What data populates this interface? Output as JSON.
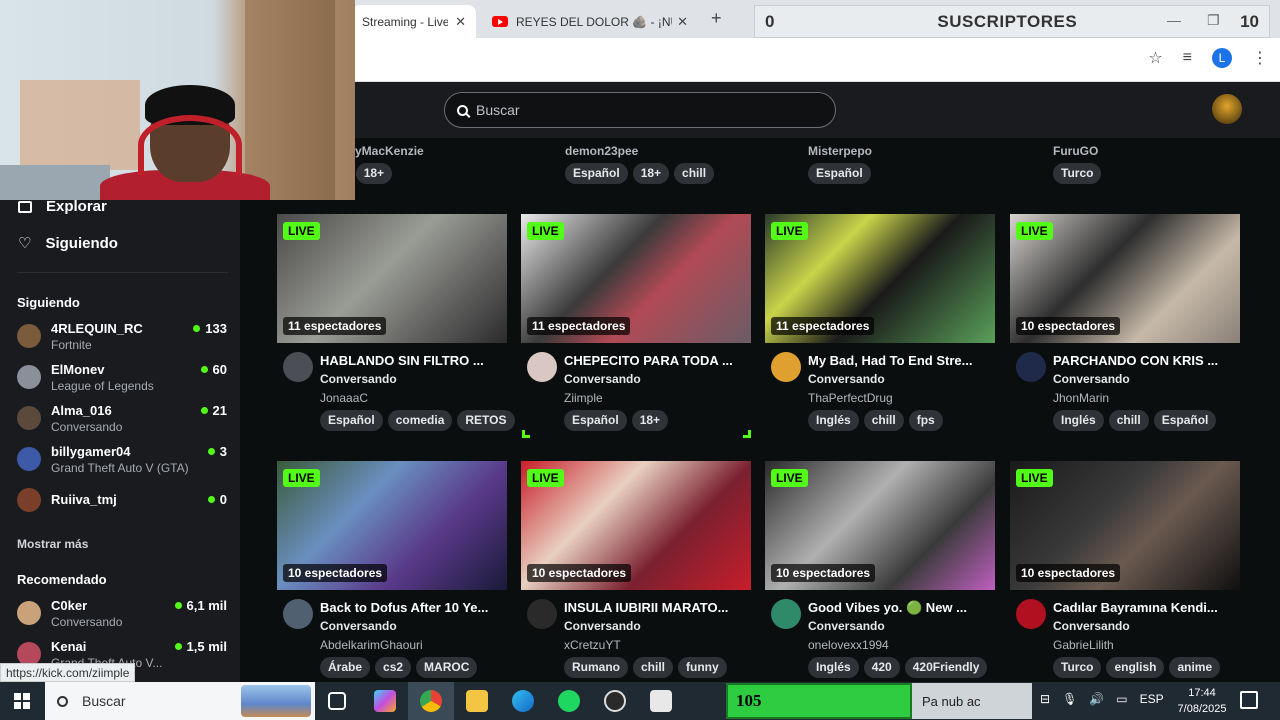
{
  "browser": {
    "tabs": [
      {
        "label": "Streaming - Live S",
        "active": true
      },
      {
        "label": "REYES DEL DOLOR 🪨 - ¡NUEVA",
        "active": false
      }
    ],
    "new_tab": "+",
    "close_glyph": "✕"
  },
  "subscribers": {
    "left": "0",
    "label": "SUSCRIPTORES",
    "right": "10"
  },
  "kick": {
    "search_placeholder": "Buscar",
    "nav": [
      {
        "label": "Explorar",
        "icon": "explore-icon"
      },
      {
        "label": "Siguiendo",
        "icon": "heart-icon"
      }
    ],
    "following_heading": "Siguiendo",
    "following": [
      {
        "name": "4RLEQUIN_RC",
        "category": "Fortnite",
        "viewers": "133",
        "color": "#7a5c3c"
      },
      {
        "name": "ElMonev",
        "category": "League of Legends",
        "viewers": "60",
        "color": "#8a8f99"
      },
      {
        "name": "Alma_016",
        "category": "Conversando",
        "viewers": "21",
        "color": "#5b4a3c"
      },
      {
        "name": "billygamer04",
        "category": "Grand Theft Auto V (GTA)",
        "viewers": "3",
        "color": "#3d5aa8"
      },
      {
        "name": "Ruiiva_tmj",
        "category": "",
        "viewers": "0",
        "color": "#7a3f2a"
      }
    ],
    "show_more": "Mostrar más",
    "recommended_heading": "Recomendado",
    "recommended": [
      {
        "name": "C0ker",
        "category": "Conversando",
        "viewers": "6,1 mil",
        "color": "#c9a27a"
      },
      {
        "name": "Kenai",
        "category": "Grand Theft Auto V...",
        "viewers": "1,5 mil",
        "color": "#b5495b"
      }
    ],
    "prev_row": [
      {
        "name": "yMacKenzie",
        "tags": [
          "s",
          "18+"
        ]
      },
      {
        "name": "demon23pee",
        "tags": [
          "Español",
          "18+",
          "chill"
        ]
      },
      {
        "name": "Misterpepo",
        "tags": [
          "Español"
        ]
      },
      {
        "name": "FuruGO",
        "tags": [
          "Turco"
        ]
      }
    ],
    "cards": [
      {
        "live": "LIVE",
        "viewers": "11 espectadores",
        "title": "HABLANDO SIN FILTRO ...",
        "category": "Conversando",
        "user": "JonaaaC",
        "tags": [
          "Español",
          "comedia",
          "RETOS"
        ],
        "thumb": "linear-gradient(135deg,#4a4a48,#9a9c96 45%,#2b2b2c)",
        "avatar": "#4b4f55"
      },
      {
        "live": "LIVE",
        "viewers": "11 espectadores",
        "title": "CHEPECITO PARA TODA ...",
        "category": "Conversando",
        "user": "Ziimple",
        "tags": [
          "Español",
          "18+"
        ],
        "thumb": "linear-gradient(135deg,#e9e9e9,#3a3a3a 40%,#b14a55 60%,#6a5c66)",
        "avatar": "#d9c7c3"
      },
      {
        "live": "LIVE",
        "viewers": "11 espectadores",
        "title": "My Bad, Had To End Stre...",
        "category": "Conversando",
        "user": "ThaPerfectDrug",
        "tags": [
          "Inglés",
          "chill",
          "fps"
        ],
        "thumb": "linear-gradient(135deg,#2a3a2a,#c9d44a 30%,#1a1a1a 55%,#5aa05a)",
        "avatar": "#e0a030"
      },
      {
        "live": "LIVE",
        "viewers": "10 espectadores",
        "title": "PARCHANDO CON KRIS ...",
        "category": "Conversando",
        "user": "JhonMarin",
        "tags": [
          "Inglés",
          "chill",
          "Español"
        ],
        "thumb": "linear-gradient(135deg,#d8d4d0,#2d2d2d 40%,#c6b9a8 70%,#8a8078)",
        "avatar": "#1f2a4a"
      },
      {
        "live": "LIVE",
        "viewers": "10 espectadores",
        "title": "Back to Dofus After 10 Ye...",
        "category": "Conversando",
        "user": "AbdelkarimGhaouri",
        "tags": [
          "Árabe",
          "cs2",
          "MAROC"
        ],
        "thumb": "linear-gradient(135deg,#3a5a3a,#6a8fc0 35%,#5a3a8a 65%,#1a1a3a)",
        "avatar": "#506070"
      },
      {
        "live": "LIVE",
        "viewers": "10 espectadores",
        "title": "INSULA IUBIRII MARATO...",
        "category": "Conversando",
        "user": "xCretzuYT",
        "tags": [
          "Rumano",
          "chill",
          "funny"
        ],
        "thumb": "linear-gradient(135deg,#c81e2a,#e8d0c0 35%,#7a2030 65%,#c81e2a)",
        "avatar": "#2a2a2a"
      },
      {
        "live": "LIVE",
        "viewers": "10 espectadores",
        "title": "Good Vibes yo. 🟢 New ...",
        "category": "Conversando",
        "user": "onelovexx1994",
        "tags": [
          "Inglés",
          "420",
          "420Friendly"
        ],
        "thumb": "linear-gradient(135deg,#2a2a2a,#b0b0b0 40%,#3a3a3a 70%,#c060c0)",
        "avatar": "#2f8a6a"
      },
      {
        "live": "LIVE",
        "viewers": "10 espectadores",
        "title": "Cadılar Bayramına Kendi...",
        "category": "Conversando",
        "user": "GabrieLilith",
        "tags": [
          "Turco",
          "english",
          "anime"
        ],
        "thumb": "linear-gradient(135deg,#1a1a1a,#3a3a3a 40%,#6a5a50 60%,#101010)",
        "avatar": "#b01020"
      }
    ]
  },
  "status_url": "https://kick.com/ziimple",
  "taskbar": {
    "search": "Buscar",
    "counter": "105",
    "ticker": "Pa  nub ac",
    "lang": "ESP",
    "time": "17:44",
    "date": "7/08/2025"
  }
}
